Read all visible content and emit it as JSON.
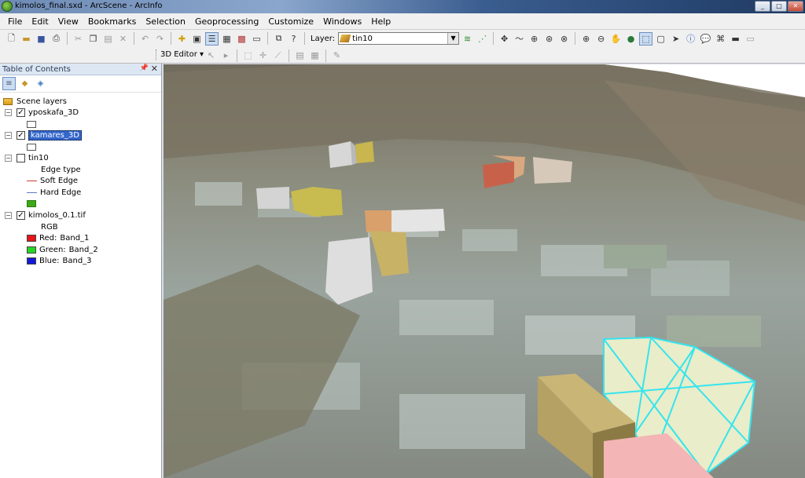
{
  "window": {
    "title": "kimolos_final.sxd - ArcScene - ArcInfo",
    "controls": [
      "_",
      "□",
      "✕"
    ]
  },
  "menu": [
    "File",
    "Edit",
    "View",
    "Bookmarks",
    "Selection",
    "Geoprocessing",
    "Customize",
    "Windows",
    "Help"
  ],
  "toolbar": {
    "layer_label": "Layer:",
    "layer_value": "tin10",
    "editor_label": "3D Editor ▾"
  },
  "toc": {
    "title": "Table of Contents",
    "root": "Scene layers",
    "layers": [
      {
        "name": "yposkafa_3D",
        "checked": true
      },
      {
        "name": "kamares_3D",
        "checked": true,
        "selected": true
      },
      {
        "name": "tin10",
        "checked": false,
        "legend_heading": "Edge type",
        "legend": [
          {
            "label": "Soft Edge",
            "color": "#cc3b32"
          },
          {
            "label": "Hard Edge",
            "color": "#5a7cc0"
          }
        ]
      },
      {
        "name": "kimolos_0.1.tif",
        "checked": true,
        "legend_heading": "RGB",
        "legend": [
          {
            "label": "Red:",
            "band": "Band_1",
            "color": "#e8141a"
          },
          {
            "label": "Green:",
            "band": "Band_2",
            "color": "#25d625"
          },
          {
            "label": "Blue:",
            "band": "Band_3",
            "color": "#1418d8"
          }
        ]
      }
    ]
  },
  "colors": {
    "selection": "#3366cc",
    "tin_edges": "#35e4ef"
  }
}
